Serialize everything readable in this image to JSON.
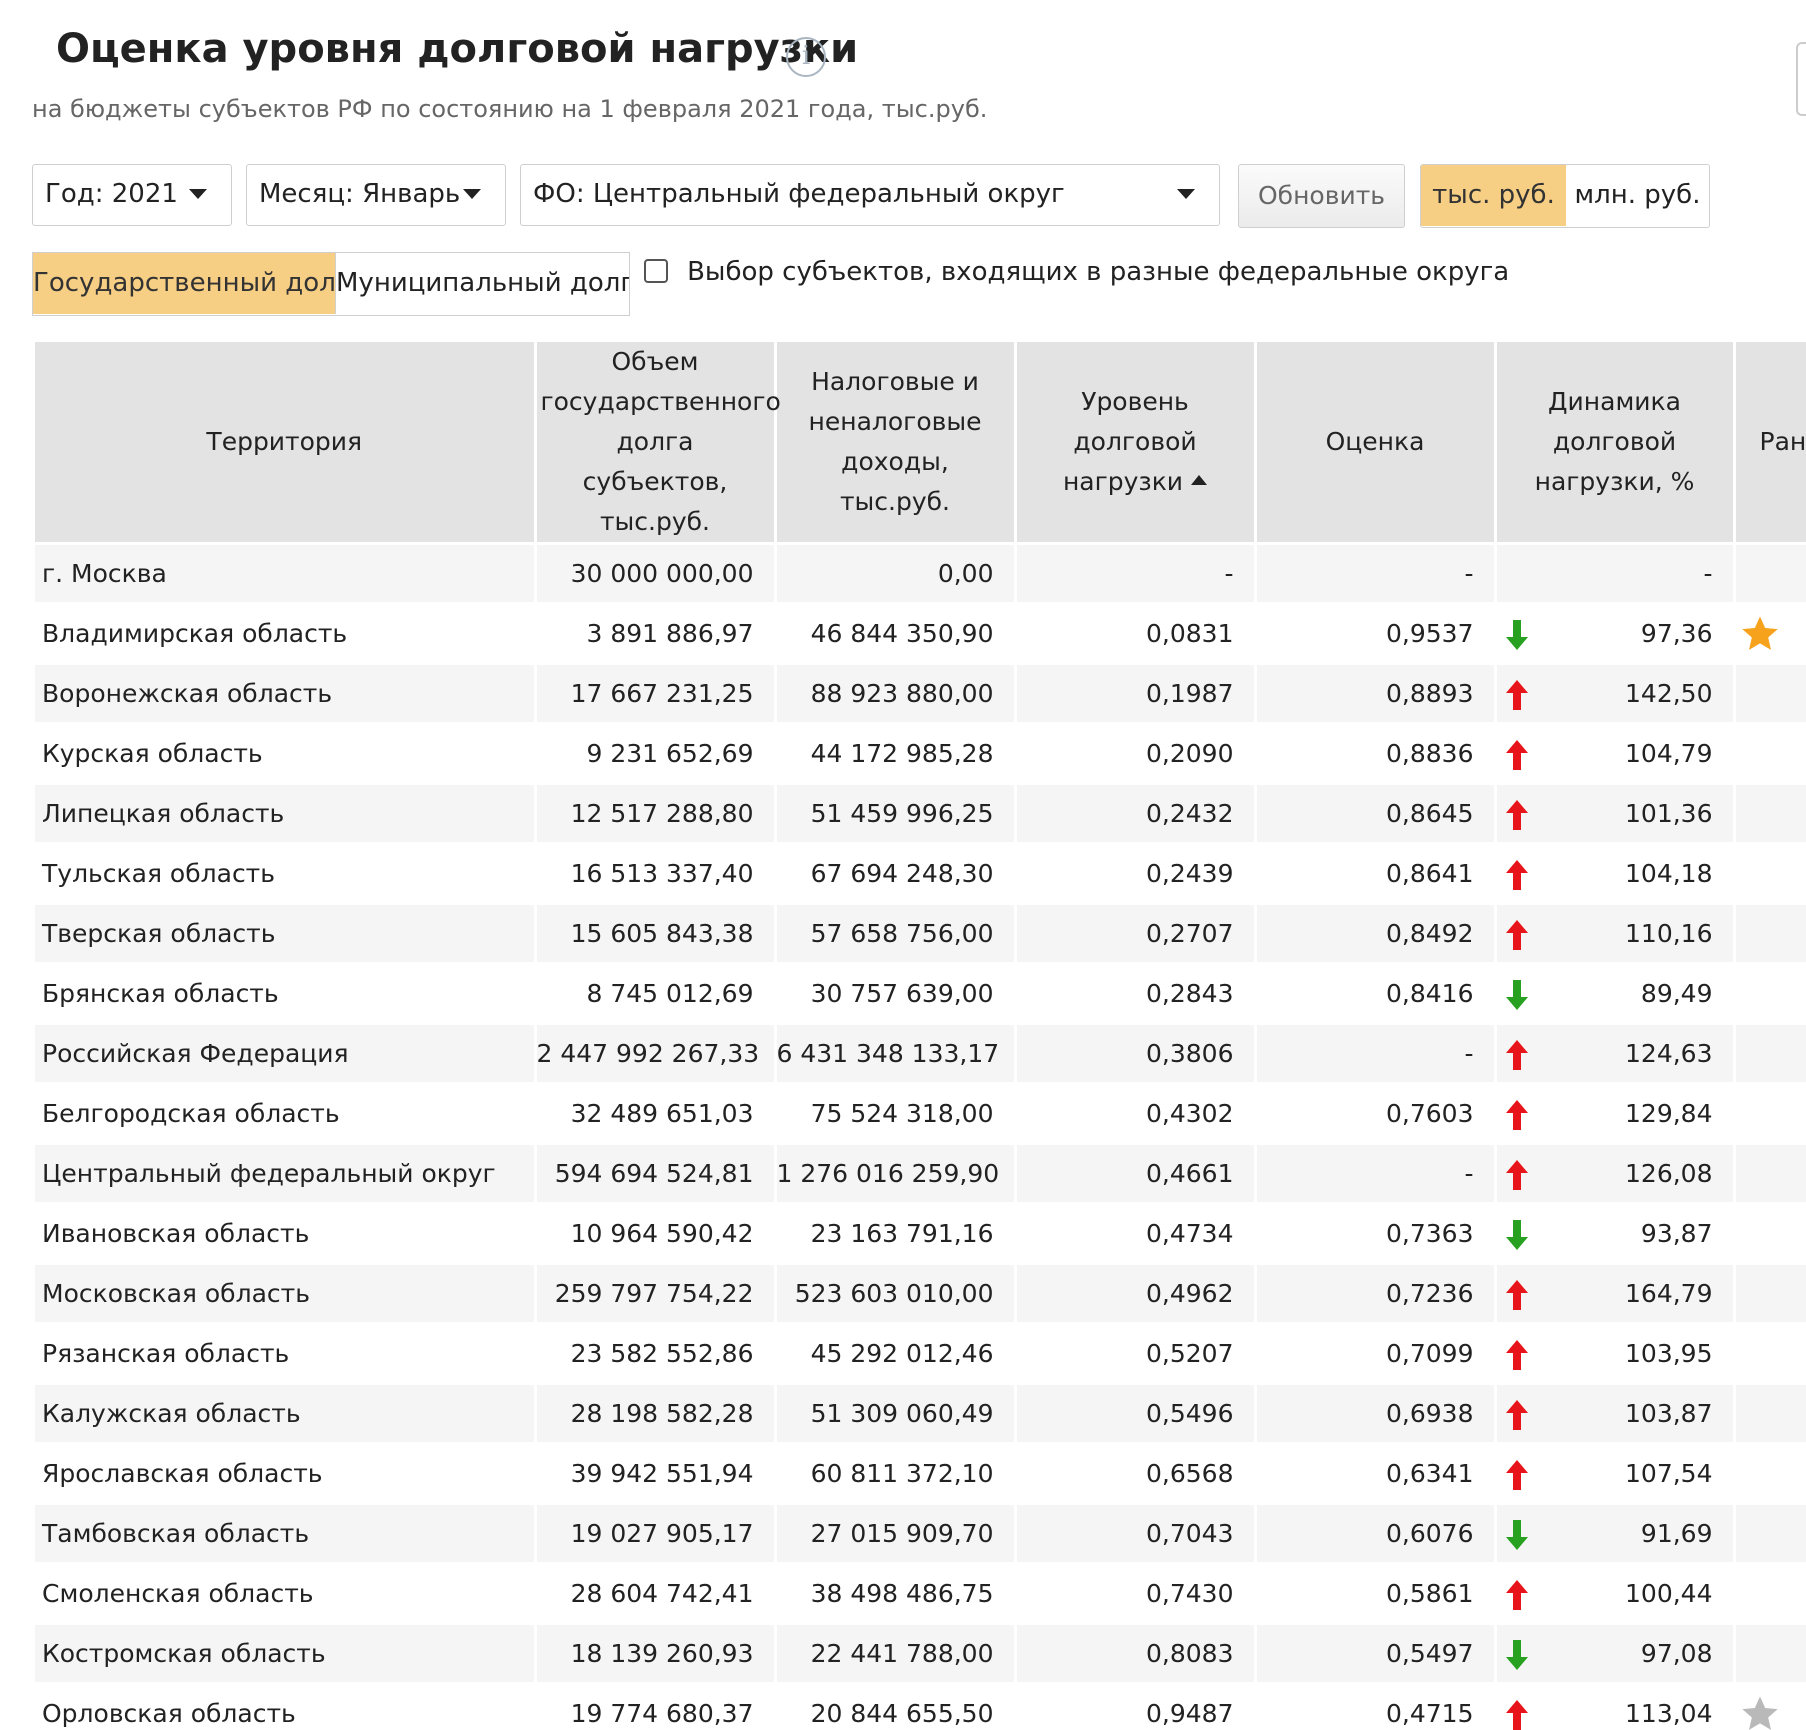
{
  "page": {
    "title": "Оценка уровня долговой нагрузки",
    "subtitle": "на бюджеты субъектов РФ по состоянию на 1 февраля 2021 года, тыс.руб.",
    "info_icon": "i"
  },
  "filters": {
    "year": "Год: 2021",
    "month": "Месяц: Январь",
    "district": "ФО: Центральный федеральный округ",
    "refresh_label": "Обновить",
    "unit_thousand": "тыс. руб.",
    "unit_million": "млн. руб.",
    "selected_unit": "тыс. руб."
  },
  "debt_tabs": {
    "state": "Государственный долг",
    "municipal": "Муниципальный долг",
    "selected": "Государственный долг"
  },
  "cross_district": {
    "label": "Выбор субъектов, входящих в разные федеральные округа",
    "checked": false
  },
  "table": {
    "headers": {
      "territory": "Территория",
      "debt_volume": "Объем государственного долга субъектов, тыс.руб.",
      "income": "Налоговые и неналоговые доходы, тыс.руб.",
      "level": "Уровень долговой нагрузки",
      "estimate": "Оценка",
      "dynamics": "Динамика долговой нагрузки, %",
      "rank": "Ран"
    },
    "sort_column": "level",
    "sort_direction": "asc",
    "colors": {
      "up_arrow": "#e8141b",
      "down_arrow": "#27a11f",
      "star_gold": "#f6a21c",
      "star_gray": "#b9b9b9"
    },
    "rows": [
      {
        "territory": "г. Москва",
        "volume": "30 000 000,00",
        "income": "0,00",
        "level": "-",
        "estimate": "-",
        "trend": "none",
        "dynamics": "-",
        "star": "none"
      },
      {
        "territory": "Владимирская область",
        "volume": "3 891 886,97",
        "income": "46 844 350,90",
        "level": "0,0831",
        "estimate": "0,9537",
        "trend": "down",
        "dynamics": "97,36",
        "star": "gold"
      },
      {
        "territory": "Воронежская область",
        "volume": "17 667 231,25",
        "income": "88 923 880,00",
        "level": "0,1987",
        "estimate": "0,8893",
        "trend": "up",
        "dynamics": "142,50",
        "star": "none"
      },
      {
        "territory": "Курская область",
        "volume": "9 231 652,69",
        "income": "44 172 985,28",
        "level": "0,2090",
        "estimate": "0,8836",
        "trend": "up",
        "dynamics": "104,79",
        "star": "none"
      },
      {
        "territory": "Липецкая область",
        "volume": "12 517 288,80",
        "income": "51 459 996,25",
        "level": "0,2432",
        "estimate": "0,8645",
        "trend": "up",
        "dynamics": "101,36",
        "star": "none"
      },
      {
        "territory": "Тульская область",
        "volume": "16 513 337,40",
        "income": "67 694 248,30",
        "level": "0,2439",
        "estimate": "0,8641",
        "trend": "up",
        "dynamics": "104,18",
        "star": "none"
      },
      {
        "territory": "Тверская область",
        "volume": "15 605 843,38",
        "income": "57 658 756,00",
        "level": "0,2707",
        "estimate": "0,8492",
        "trend": "up",
        "dynamics": "110,16",
        "star": "none"
      },
      {
        "territory": "Брянская область",
        "volume": "8 745 012,69",
        "income": "30 757 639,00",
        "level": "0,2843",
        "estimate": "0,8416",
        "trend": "down",
        "dynamics": "89,49",
        "star": "none"
      },
      {
        "territory": "Российская Федерация",
        "volume": "2 447 992 267,33",
        "income": "6 431 348 133,17",
        "level": "0,3806",
        "estimate": "-",
        "trend": "up",
        "dynamics": "124,63",
        "star": "none"
      },
      {
        "territory": "Белгородская область",
        "volume": "32 489 651,03",
        "income": "75 524 318,00",
        "level": "0,4302",
        "estimate": "0,7603",
        "trend": "up",
        "dynamics": "129,84",
        "star": "none"
      },
      {
        "territory": "Центральный федеральный округ",
        "volume": "594 694 524,81",
        "income": "1 276 016 259,90",
        "level": "0,4661",
        "estimate": "-",
        "trend": "up",
        "dynamics": "126,08",
        "star": "none"
      },
      {
        "territory": "Ивановская область",
        "volume": "10 964 590,42",
        "income": "23 163 791,16",
        "level": "0,4734",
        "estimate": "0,7363",
        "trend": "down",
        "dynamics": "93,87",
        "star": "none"
      },
      {
        "territory": "Московская область",
        "volume": "259 797 754,22",
        "income": "523 603 010,00",
        "level": "0,4962",
        "estimate": "0,7236",
        "trend": "up",
        "dynamics": "164,79",
        "star": "none"
      },
      {
        "territory": "Рязанская область",
        "volume": "23 582 552,86",
        "income": "45 292 012,46",
        "level": "0,5207",
        "estimate": "0,7099",
        "trend": "up",
        "dynamics": "103,95",
        "star": "none"
      },
      {
        "territory": "Калужская область",
        "volume": "28 198 582,28",
        "income": "51 309 060,49",
        "level": "0,5496",
        "estimate": "0,6938",
        "trend": "up",
        "dynamics": "103,87",
        "star": "none"
      },
      {
        "territory": "Ярославская область",
        "volume": "39 942 551,94",
        "income": "60 811 372,10",
        "level": "0,6568",
        "estimate": "0,6341",
        "trend": "up",
        "dynamics": "107,54",
        "star": "none"
      },
      {
        "territory": "Тамбовская область",
        "volume": "19 027 905,17",
        "income": "27 015 909,70",
        "level": "0,7043",
        "estimate": "0,6076",
        "trend": "down",
        "dynamics": "91,69",
        "star": "none"
      },
      {
        "territory": "Смоленская область",
        "volume": "28 604 742,41",
        "income": "38 498 486,75",
        "level": "0,7430",
        "estimate": "0,5861",
        "trend": "up",
        "dynamics": "100,44",
        "star": "none"
      },
      {
        "territory": "Костромская область",
        "volume": "18 139 260,93",
        "income": "22 441 788,00",
        "level": "0,8083",
        "estimate": "0,5497",
        "trend": "down",
        "dynamics": "97,08",
        "star": "none"
      },
      {
        "territory": "Орловская область",
        "volume": "19 774 680,37",
        "income": "20 844 655,50",
        "level": "0,9487",
        "estimate": "0,4715",
        "trend": "up",
        "dynamics": "113,04",
        "star": "gray"
      }
    ]
  }
}
